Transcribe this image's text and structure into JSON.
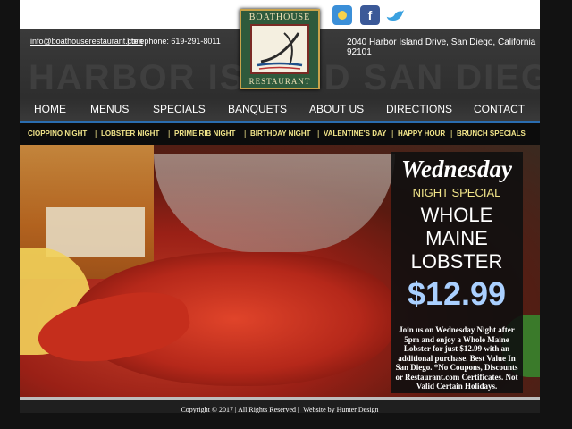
{
  "header": {
    "email": "info@boathouserestaurant.com",
    "phone": "|  telephone: 619-291-8011",
    "address": "2040 Harbor Island Drive, San Diego, California 92101",
    "watermark": "HARBOR ISLAND SAN DIEGO"
  },
  "logo": {
    "top": "BOATHOUSE",
    "bottom": "RESTAURANT"
  },
  "social": {
    "weather_icon": "weather-icon",
    "facebook_label": "f",
    "twitter_icon": "bird-icon"
  },
  "nav": {
    "items": [
      "HOME",
      "MENUS",
      "SPECIALS",
      "BANQUETS",
      "ABOUT US",
      "DIRECTIONS",
      "CONTACT"
    ]
  },
  "subnav": {
    "items": [
      "CIOPPINO NIGHT",
      "LOBSTER NIGHT",
      "PRIME RIB NIGHT",
      "BIRTHDAY NIGHT",
      "VALENTINE'S DAY",
      "HAPPY HOUR",
      "BRUNCH SPECIALS"
    ]
  },
  "promo": {
    "day": "Wednesday",
    "special": "NIGHT SPECIAL",
    "line1": "WHOLE",
    "line2": "MAINE",
    "line3": "LOBSTER",
    "price": "$12.99",
    "body": "Join us on Wednesday Night after 5pm and enjoy a Whole Maine Lobster for just $12.99 with an additional purchase. Best Value In San Diego. *No Coupons, Discounts or Restaurant.com Certificates. Not Valid Certain Holidays."
  },
  "footer": {
    "copyright": "Copyright © 2017 | All Rights Reserved |",
    "credit": "Website by Hunter Design"
  },
  "colors": {
    "accent_blue": "#2a6db0",
    "subnav_text": "#f2e58a",
    "price": "#aad0ff"
  }
}
